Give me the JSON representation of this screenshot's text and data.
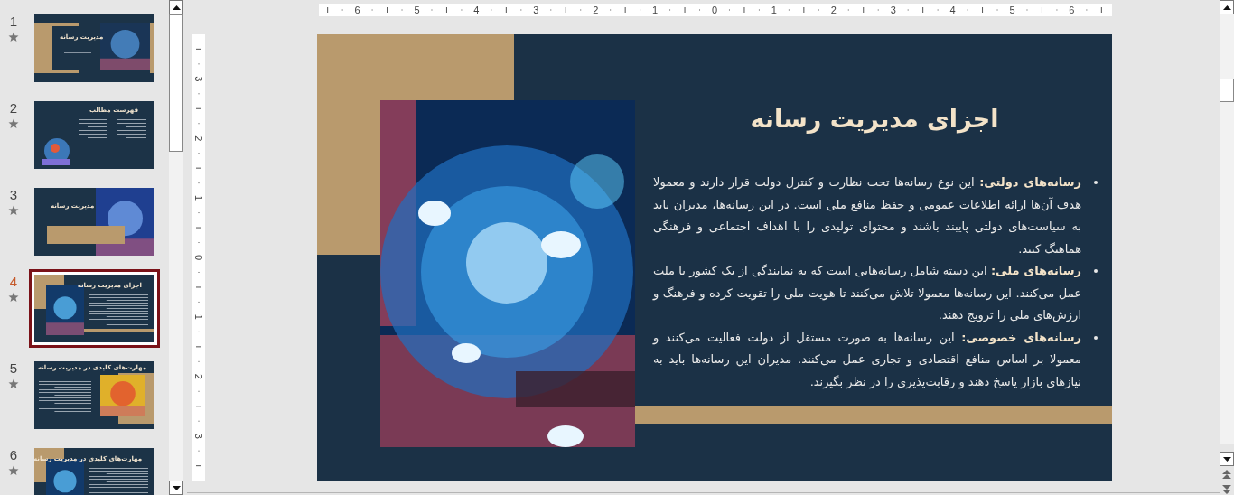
{
  "thumbnails": [
    {
      "number": "1",
      "title": "مدیریت رسانه",
      "kind": "title",
      "selected": false
    },
    {
      "number": "2",
      "title": "فهرست مطالب",
      "kind": "agenda",
      "selected": false
    },
    {
      "number": "3",
      "title": "مدیریت رسانه",
      "kind": "picture-right",
      "selected": false
    },
    {
      "number": "4",
      "title": "اجزای مدیریت رسانه",
      "kind": "picture-left",
      "selected": true
    },
    {
      "number": "5",
      "title": "مهارت‌های کلیدی در مدیریت رسانه",
      "kind": "picture-right-framed",
      "selected": false
    },
    {
      "number": "6",
      "title": "مهارت‌های کلیدی در مدیریت رسانه",
      "kind": "picture-left",
      "selected": false
    }
  ],
  "horizontal_ruler": {
    "labels": [
      "6",
      "5",
      "4",
      "3",
      "2",
      "1",
      "0",
      "1",
      "2",
      "3",
      "4",
      "5",
      "6"
    ]
  },
  "vertical_ruler": {
    "labels": [
      "3",
      "2",
      "1",
      "0",
      "1",
      "2",
      "3"
    ]
  },
  "slide": {
    "title": "اجزای مدیریت رسانه",
    "bullets": [
      {
        "text": "**رسانه‌های دولتی:** این نوع رسانه‌ها تحت نظارت و کنترل دولت قرار دارند و معمولا هدف آن‌ها ارائه اطلاعات عمومی و حفظ منافع ملی است. در این رسانه‌ها، مدیران باید به سیاست‌های دولتی پایبند باشند و محتوای تولیدی را با اهداف اجتماعی و فرهنگی هماهنگ کنند."
      },
      {
        "text": "**رسانه‌های ملی:** این دسته شامل رسانه‌هایی است که به نمایندگی از یک کشور یا ملت عمل می‌کنند. این رسانه‌ها معمولا تلاش می‌کنند تا هویت ملی را تقویت کرده و فرهنگ و ارزش‌های ملی را ترویج دهند."
      },
      {
        "text": "**رسانه‌های خصوصی:** این رسانه‌ها به صورت مستقل از دولت فعالیت می‌کنند و معمولا بر اساس منافع اقتصادی و تجاری عمل می‌کنند. مدیران این رسانه‌ها باید به نیازهای بازار پاسخ دهند و رقابت‌پذیری را در نظر بگیرند."
      }
    ]
  }
}
